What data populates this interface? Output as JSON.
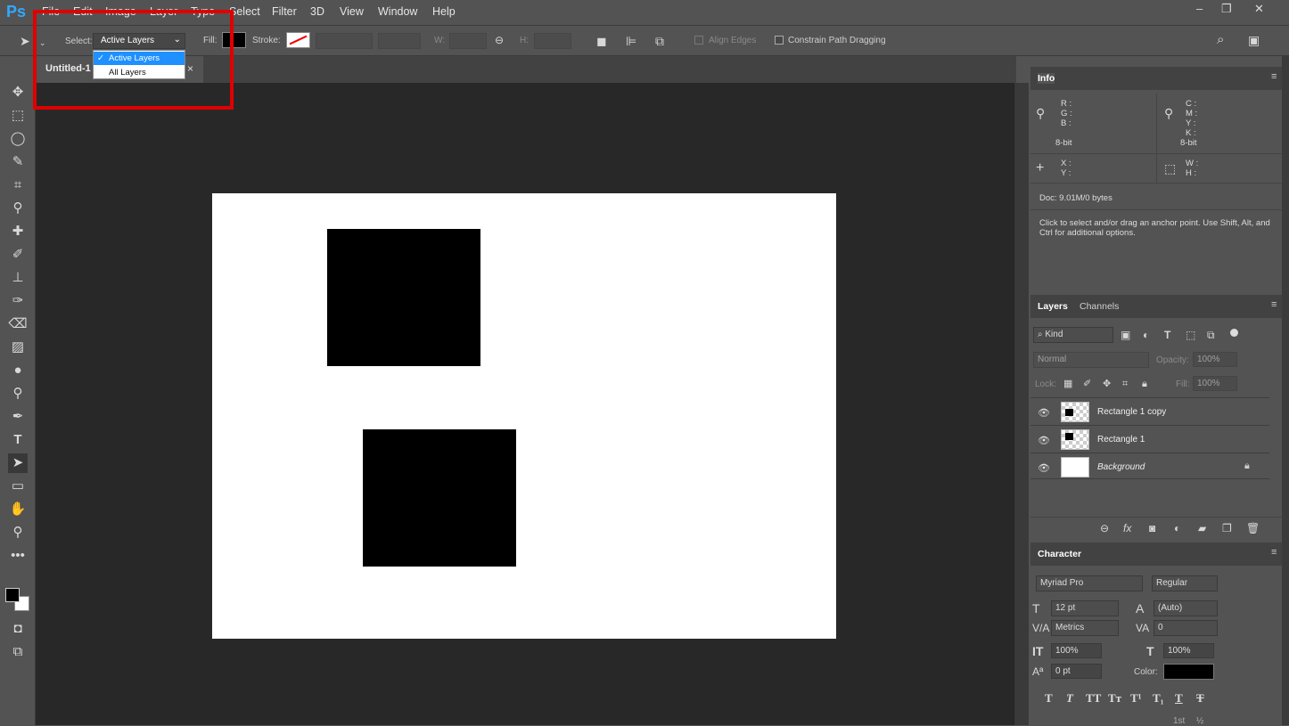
{
  "app": {
    "logo": "Ps"
  },
  "menu": {
    "items": [
      "File",
      "Edit",
      "Image",
      "Layer",
      "Type",
      "Select",
      "Filter",
      "3D",
      "View",
      "Window",
      "Help"
    ]
  },
  "window_controls": {
    "minimize": "–",
    "restore": "❐",
    "close": "✕"
  },
  "options": {
    "select_label": "Select:",
    "select_value": "Active Layers",
    "fill_label": "Fill:",
    "stroke_label": "Stroke:",
    "w_label": "W:",
    "h_label": "H:",
    "align_edges": "Align Edges",
    "constrain": "Constrain Path Dragging",
    "dropdown_options": [
      "Active Layers",
      "All Layers"
    ]
  },
  "document": {
    "tab_title": "Untitled-1",
    "close": "×"
  },
  "info": {
    "tab": "Info",
    "rgb": [
      "R :",
      "G :",
      "B :"
    ],
    "cmyk": [
      "C :",
      "M :",
      "Y :",
      "K :"
    ],
    "bit_left": "8-bit",
    "bit_right": "8-bit",
    "xy": [
      "X :",
      "Y :"
    ],
    "wh": [
      "W :",
      "H :"
    ],
    "doc": "Doc: 9.01M/0 bytes",
    "hint": "Click to select and/or drag an anchor point.  Use Shift, Alt, and Ctrl for additional options."
  },
  "layers": {
    "tabs": [
      "Layers",
      "Channels"
    ],
    "kind": "Kind",
    "blend": "Normal",
    "opacity_label": "Opacity:",
    "opacity": "100%",
    "lock_label": "Lock:",
    "fill_label": "Fill:",
    "fill": "100%",
    "items": [
      "Rectangle 1 copy",
      "Rectangle 1",
      "Background"
    ]
  },
  "character": {
    "tab": "Character",
    "font": "Myriad Pro",
    "style": "Regular",
    "size": "12 pt",
    "leading": "(Auto)",
    "kerning": "Metrics",
    "tracking": "0",
    "vscale": "100%",
    "hscale": "100%",
    "baseline": "0 pt",
    "color_label": "Color:",
    "styles": [
      "T",
      "T",
      "TT",
      "Tт",
      "T¹",
      "T₁",
      "T",
      "T"
    ],
    "extra": [
      "1st",
      "½"
    ]
  },
  "colors": {
    "accent": "#31a8ff",
    "highlight_box": "#e00000",
    "selection": "#1e90ff"
  }
}
